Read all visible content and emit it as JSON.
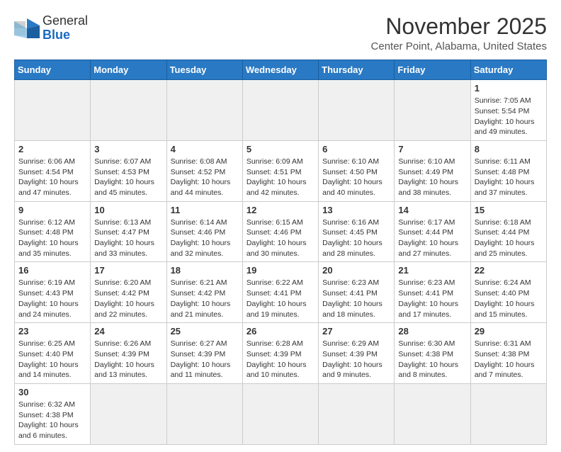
{
  "logo": {
    "general": "General",
    "blue": "Blue"
  },
  "title": "November 2025",
  "location": "Center Point, Alabama, United States",
  "weekdays": [
    "Sunday",
    "Monday",
    "Tuesday",
    "Wednesday",
    "Thursday",
    "Friday",
    "Saturday"
  ],
  "weeks": [
    [
      {
        "day": "",
        "info": ""
      },
      {
        "day": "",
        "info": ""
      },
      {
        "day": "",
        "info": ""
      },
      {
        "day": "",
        "info": ""
      },
      {
        "day": "",
        "info": ""
      },
      {
        "day": "",
        "info": ""
      },
      {
        "day": "1",
        "info": "Sunrise: 7:05 AM\nSunset: 5:54 PM\nDaylight: 10 hours and 49 minutes."
      }
    ],
    [
      {
        "day": "2",
        "info": "Sunrise: 6:06 AM\nSunset: 4:54 PM\nDaylight: 10 hours and 47 minutes."
      },
      {
        "day": "3",
        "info": "Sunrise: 6:07 AM\nSunset: 4:53 PM\nDaylight: 10 hours and 45 minutes."
      },
      {
        "day": "4",
        "info": "Sunrise: 6:08 AM\nSunset: 4:52 PM\nDaylight: 10 hours and 44 minutes."
      },
      {
        "day": "5",
        "info": "Sunrise: 6:09 AM\nSunset: 4:51 PM\nDaylight: 10 hours and 42 minutes."
      },
      {
        "day": "6",
        "info": "Sunrise: 6:10 AM\nSunset: 4:50 PM\nDaylight: 10 hours and 40 minutes."
      },
      {
        "day": "7",
        "info": "Sunrise: 6:10 AM\nSunset: 4:49 PM\nDaylight: 10 hours and 38 minutes."
      },
      {
        "day": "8",
        "info": "Sunrise: 6:11 AM\nSunset: 4:48 PM\nDaylight: 10 hours and 37 minutes."
      }
    ],
    [
      {
        "day": "9",
        "info": "Sunrise: 6:12 AM\nSunset: 4:48 PM\nDaylight: 10 hours and 35 minutes."
      },
      {
        "day": "10",
        "info": "Sunrise: 6:13 AM\nSunset: 4:47 PM\nDaylight: 10 hours and 33 minutes."
      },
      {
        "day": "11",
        "info": "Sunrise: 6:14 AM\nSunset: 4:46 PM\nDaylight: 10 hours and 32 minutes."
      },
      {
        "day": "12",
        "info": "Sunrise: 6:15 AM\nSunset: 4:46 PM\nDaylight: 10 hours and 30 minutes."
      },
      {
        "day": "13",
        "info": "Sunrise: 6:16 AM\nSunset: 4:45 PM\nDaylight: 10 hours and 28 minutes."
      },
      {
        "day": "14",
        "info": "Sunrise: 6:17 AM\nSunset: 4:44 PM\nDaylight: 10 hours and 27 minutes."
      },
      {
        "day": "15",
        "info": "Sunrise: 6:18 AM\nSunset: 4:44 PM\nDaylight: 10 hours and 25 minutes."
      }
    ],
    [
      {
        "day": "16",
        "info": "Sunrise: 6:19 AM\nSunset: 4:43 PM\nDaylight: 10 hours and 24 minutes."
      },
      {
        "day": "17",
        "info": "Sunrise: 6:20 AM\nSunset: 4:42 PM\nDaylight: 10 hours and 22 minutes."
      },
      {
        "day": "18",
        "info": "Sunrise: 6:21 AM\nSunset: 4:42 PM\nDaylight: 10 hours and 21 minutes."
      },
      {
        "day": "19",
        "info": "Sunrise: 6:22 AM\nSunset: 4:41 PM\nDaylight: 10 hours and 19 minutes."
      },
      {
        "day": "20",
        "info": "Sunrise: 6:23 AM\nSunset: 4:41 PM\nDaylight: 10 hours and 18 minutes."
      },
      {
        "day": "21",
        "info": "Sunrise: 6:23 AM\nSunset: 4:41 PM\nDaylight: 10 hours and 17 minutes."
      },
      {
        "day": "22",
        "info": "Sunrise: 6:24 AM\nSunset: 4:40 PM\nDaylight: 10 hours and 15 minutes."
      }
    ],
    [
      {
        "day": "23",
        "info": "Sunrise: 6:25 AM\nSunset: 4:40 PM\nDaylight: 10 hours and 14 minutes."
      },
      {
        "day": "24",
        "info": "Sunrise: 6:26 AM\nSunset: 4:39 PM\nDaylight: 10 hours and 13 minutes."
      },
      {
        "day": "25",
        "info": "Sunrise: 6:27 AM\nSunset: 4:39 PM\nDaylight: 10 hours and 11 minutes."
      },
      {
        "day": "26",
        "info": "Sunrise: 6:28 AM\nSunset: 4:39 PM\nDaylight: 10 hours and 10 minutes."
      },
      {
        "day": "27",
        "info": "Sunrise: 6:29 AM\nSunset: 4:39 PM\nDaylight: 10 hours and 9 minutes."
      },
      {
        "day": "28",
        "info": "Sunrise: 6:30 AM\nSunset: 4:38 PM\nDaylight: 10 hours and 8 minutes."
      },
      {
        "day": "29",
        "info": "Sunrise: 6:31 AM\nSunset: 4:38 PM\nDaylight: 10 hours and 7 minutes."
      }
    ],
    [
      {
        "day": "30",
        "info": "Sunrise: 6:32 AM\nSunset: 4:38 PM\nDaylight: 10 hours and 6 minutes."
      },
      {
        "day": "",
        "info": ""
      },
      {
        "day": "",
        "info": ""
      },
      {
        "day": "",
        "info": ""
      },
      {
        "day": "",
        "info": ""
      },
      {
        "day": "",
        "info": ""
      },
      {
        "day": "",
        "info": ""
      }
    ]
  ]
}
